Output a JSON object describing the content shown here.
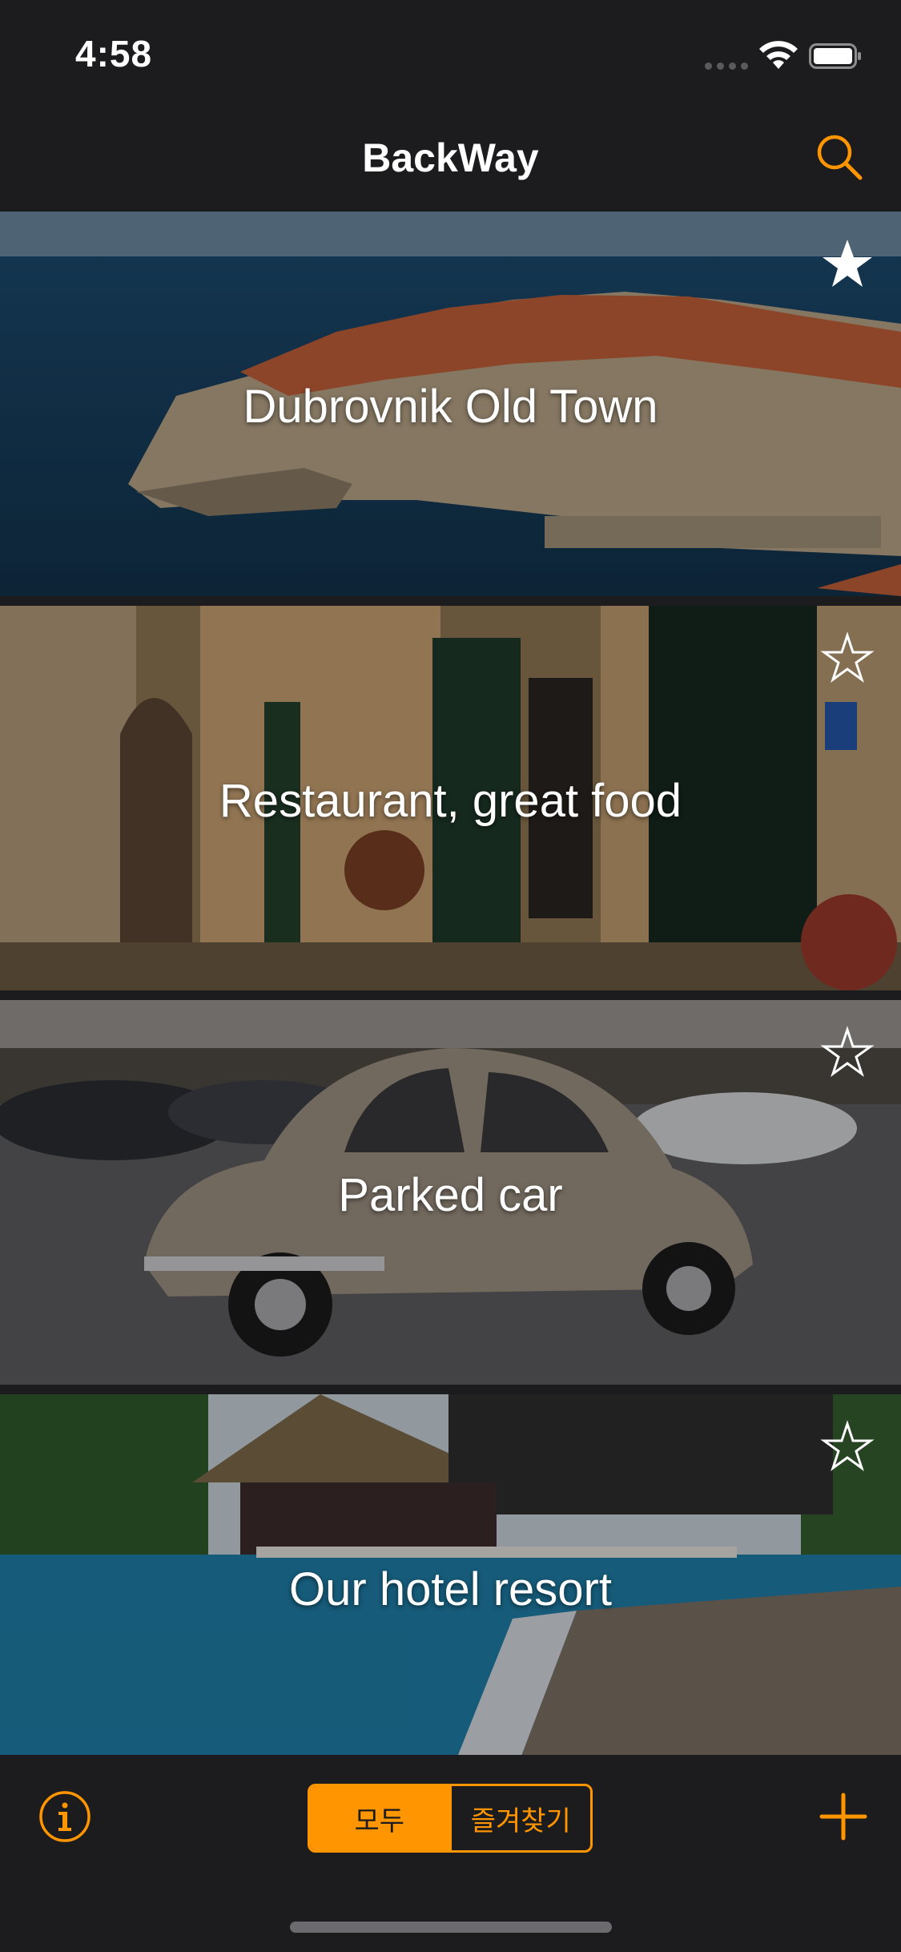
{
  "status_bar": {
    "time": "4:58"
  },
  "nav": {
    "title": "BackWay",
    "search_icon": "search-icon"
  },
  "colors": {
    "accent": "#ff9500",
    "background": "#1c1c1e"
  },
  "locations": [
    {
      "title": "Dubrovnik Old Town",
      "favorite": true,
      "photo": "walled old town by the sea"
    },
    {
      "title": "Restaurant, great food",
      "favorite": false,
      "photo": "narrow street with restaurant storefront"
    },
    {
      "title": "Parked car",
      "favorite": false,
      "photo": "vintage beetle in a parking lot"
    },
    {
      "title": "Our hotel resort",
      "favorite": false,
      "photo": "pool with thatched cabana"
    }
  ],
  "toolbar": {
    "info_icon": "info-icon",
    "segments": [
      {
        "label": "모두",
        "selected": true
      },
      {
        "label": "즐겨찾기",
        "selected": false
      }
    ],
    "add_icon": "plus-icon"
  }
}
